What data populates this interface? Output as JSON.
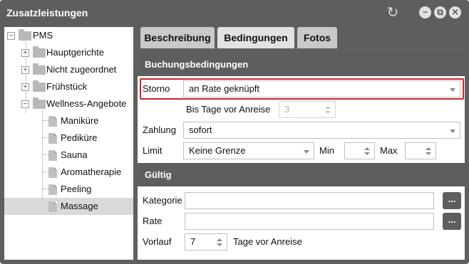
{
  "window": {
    "title": "Zusatzleistungen",
    "refresh_icon": "refresh-icon",
    "minimize_icon": "minimize-icon",
    "maximize_icon": "restore-icon",
    "close_icon": "close-icon"
  },
  "tree": {
    "root": "PMS",
    "folders": [
      "Hauptgerichte",
      "Nicht zugeordnet",
      "Frühstück",
      "Wellness-Angebote"
    ],
    "wellness_items": [
      "Maniküre",
      "Pediküre",
      "Sauna",
      "Aromatherapie",
      "Peeling",
      "Massage"
    ],
    "selected": "Massage"
  },
  "tabs": [
    {
      "label": "Beschreibung",
      "active": false
    },
    {
      "label": "Bedingungen",
      "active": true
    },
    {
      "label": "Fotos",
      "active": false
    }
  ],
  "sections": {
    "buchung": "Buchungsbedingungen",
    "gueltig": "Gültig"
  },
  "form": {
    "storno_label": "Storno",
    "storno_value": "an Rate geknüpft",
    "bis_tage_label": "Bis Tage vor Anreise",
    "bis_tage_value": "3",
    "zahlung_label": "Zahlung",
    "zahlung_value": "sofort",
    "limit_label": "Limit",
    "limit_value": "Keine Grenze",
    "min_label": "Min",
    "min_value": "",
    "max_label": "Max",
    "max_value": "",
    "kategorie_label": "Kategorie",
    "kategorie_value": "",
    "rate_label": "Rate",
    "rate_value": "",
    "browse_label": "...",
    "vorlauf_label": "Vorlauf",
    "vorlauf_value": "7",
    "vorlauf_suffix": "Tage vor Anreise"
  },
  "colors": {
    "header_bg": "#5e5e5e",
    "focus_border": "#c8252c",
    "tab_active": "#e2e2e2",
    "tab_inactive": "#c9c9c9",
    "selected_row": "#d9d9d9"
  }
}
